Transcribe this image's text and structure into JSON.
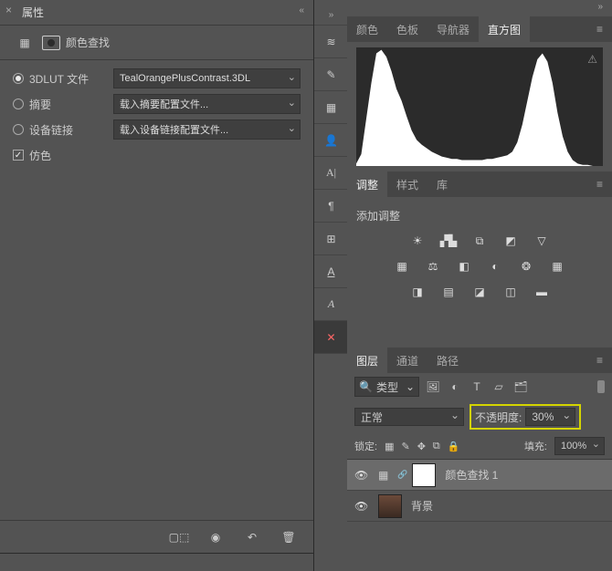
{
  "properties": {
    "title": "属性",
    "subtitle": "颜色查找",
    "lut_label": "3DLUT 文件",
    "lut_value": "TealOrangePlusContrast.3DL",
    "abstract_label": "摘要",
    "abstract_value": "载入摘要配置文件...",
    "device_label": "设备链接",
    "device_value": "载入设备链接配置文件...",
    "dither_label": "仿色"
  },
  "top_tabs": {
    "color": "颜色",
    "swatches": "色板",
    "navigator": "导航器",
    "histogram": "直方图"
  },
  "adjust_tabs": {
    "adjust": "调整",
    "styles": "样式",
    "library": "库"
  },
  "add_adjust": "添加调整",
  "layer_tabs": {
    "layers": "图层",
    "channels": "通道",
    "paths": "路径"
  },
  "filter_kind": "类型",
  "blend_mode": "正常",
  "opacity_label": "不透明度:",
  "opacity_value": "30%",
  "lock_label": "锁定:",
  "fill_label": "填充:",
  "fill_value": "100%",
  "layers": {
    "item0": "颜色查找 1",
    "item1": "背景"
  },
  "chart_data": {
    "type": "area",
    "title": "直方图",
    "xlabel": "",
    "ylabel": "",
    "xlim": [
      0,
      255
    ],
    "ylim": [
      0,
      100
    ],
    "note": "Bimodal luminance histogram: large shadow peak near 0–30, low mid-tones, secondary highlight peak near 200–230",
    "values": [
      2,
      10,
      40,
      70,
      95,
      98,
      92,
      80,
      65,
      55,
      42,
      30,
      22,
      18,
      15,
      12,
      10,
      8,
      7,
      6,
      6,
      5,
      5,
      5,
      5,
      5,
      6,
      6,
      7,
      8,
      9,
      12,
      20,
      35,
      55,
      75,
      90,
      95,
      88,
      70,
      45,
      25,
      12,
      5,
      2,
      1,
      1,
      0,
      0,
      0
    ]
  }
}
